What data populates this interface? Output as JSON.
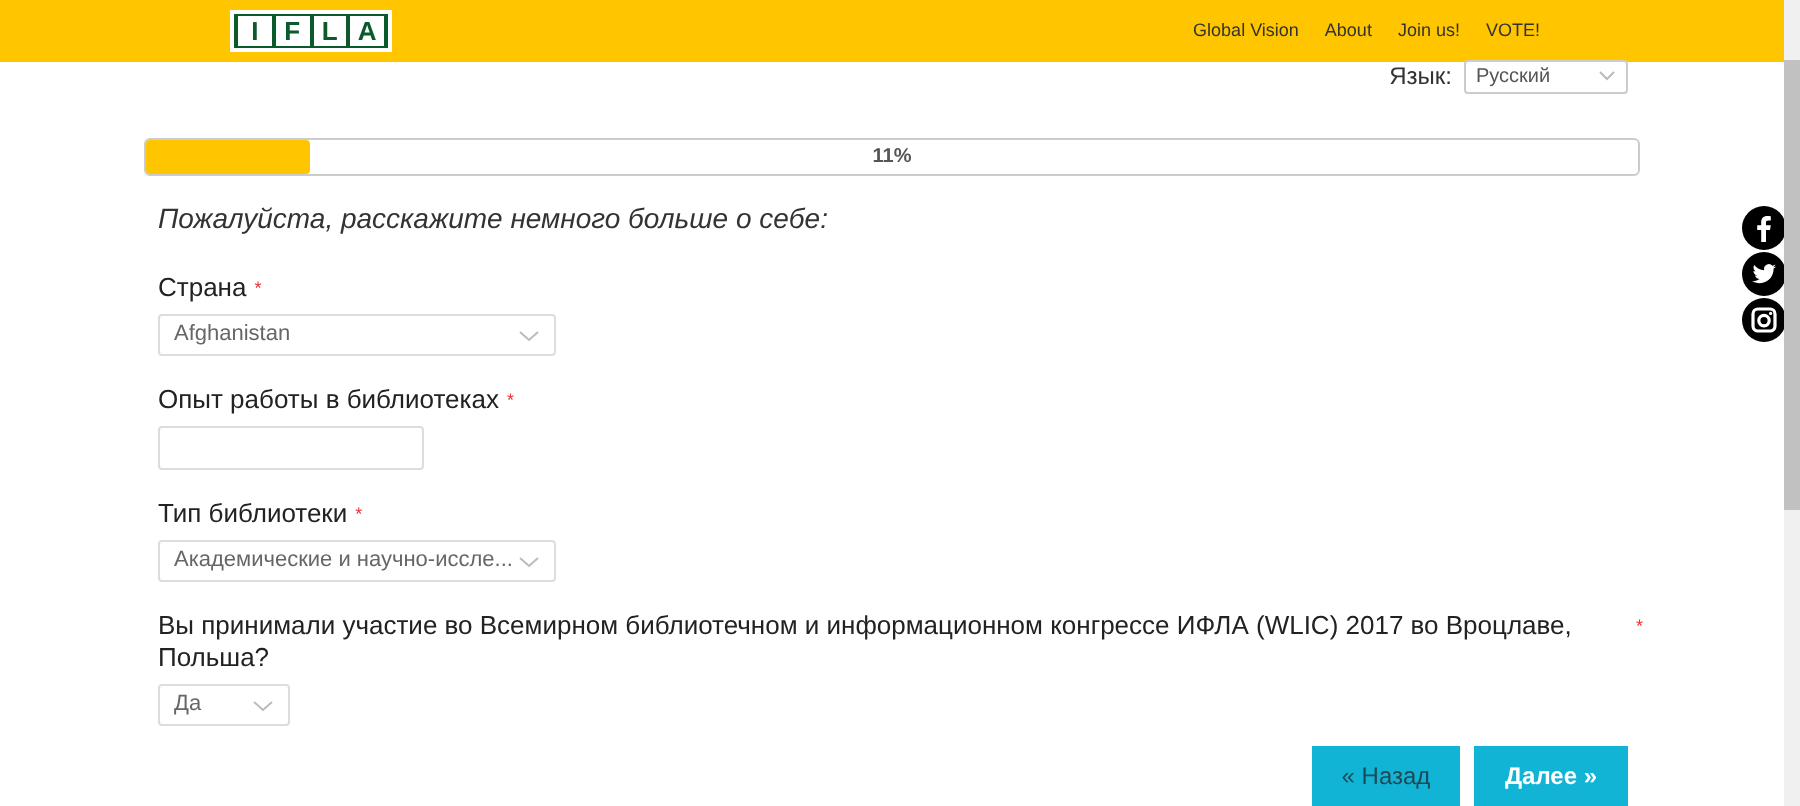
{
  "header": {
    "logo": [
      "I",
      "F",
      "L",
      "A"
    ],
    "nav": [
      "Global Vision",
      "About",
      "Join us!",
      "VOTE!"
    ]
  },
  "language": {
    "label": "Язык:",
    "value": "Русский"
  },
  "progress": {
    "level": 0.11,
    "label": "11%"
  },
  "intro": "Пожалуйста, расскажите немного больше о себе:",
  "fields": [
    {
      "kind": "select",
      "label": "Страна",
      "required_mark": "*",
      "value": "Afghanistan"
    },
    {
      "kind": "text",
      "label": "Опыт работы в библиотеках",
      "required_mark": "*"
    },
    {
      "kind": "select",
      "label": "Тип библиотеки",
      "required_mark": "*",
      "value": "Академические и научно-иссле..."
    },
    {
      "kind": "select_short",
      "label": "Вы принимали участие во Всемирном библиотечном и информационном конгрессе ИФЛА (WLIC) 2017 во Вроцлаве, Польша?",
      "required_mark": "*",
      "value": "Да"
    }
  ],
  "buttons": [
    "« Назад",
    "Далее »"
  ]
}
